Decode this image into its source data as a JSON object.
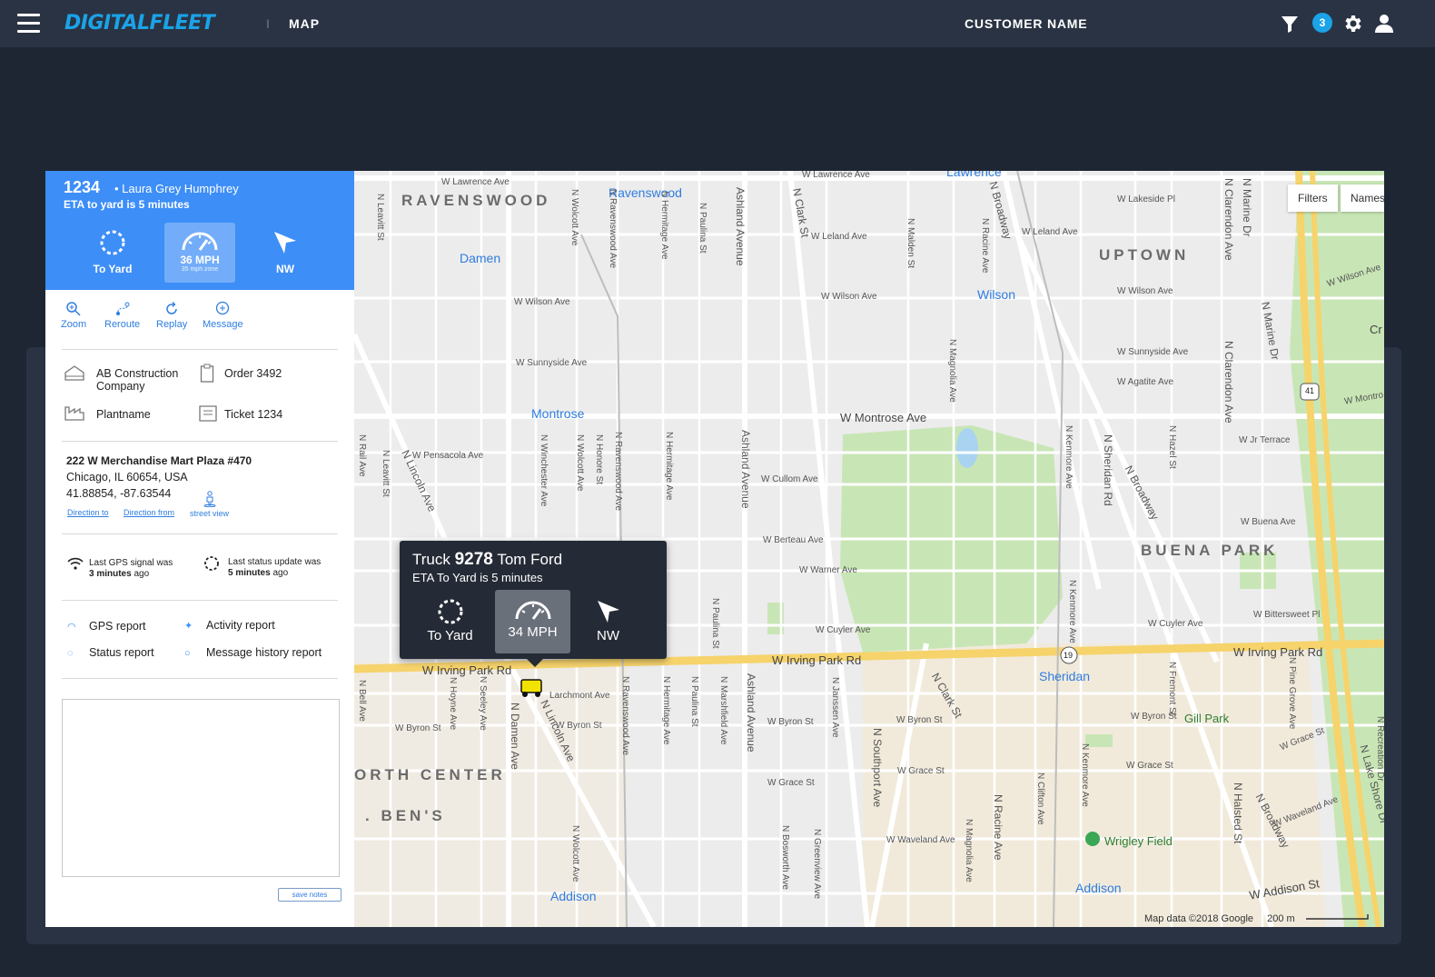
{
  "header": {
    "logo": "DIGITALFLEET",
    "separator": "I",
    "page_title": "MAP",
    "customer_name": "CUSTOMER NAME",
    "notification_count": "3"
  },
  "panel": {
    "truck_number": "1234",
    "driver": "• Laura Grey Humphrey",
    "eta": "ETA to yard is 5 minutes",
    "buttons": {
      "destination": "To Yard",
      "speed": "36 MPH",
      "speed_zone": "35 mph zone",
      "heading": "NW"
    },
    "actions": {
      "zoom": "Zoom",
      "reroute": "Reroute",
      "replay": "Replay",
      "message": "Message"
    },
    "info": {
      "company": "AB Construction Company",
      "order": "Order 3492",
      "plant": "Plantname",
      "ticket": "Ticket 1234"
    },
    "address": {
      "line1": "222 W Merchandise Mart Plaza #470",
      "line2": "Chicago, IL 60654, USA",
      "coords": "41.88854, -87.63544",
      "direction_to": "Direction to",
      "direction_from": "Direction from",
      "street_view": "street view"
    },
    "status": {
      "gps_prefix": "Last GPS signal was",
      "gps_time": "3 minutes",
      "gps_suffix": "ago",
      "update_prefix": "Last status update was",
      "update_time": "5 minutes",
      "update_suffix": "ago"
    },
    "reports": {
      "gps": "GPS report",
      "activity": "Activity report",
      "status": "Status report",
      "message_history": "Message history report"
    },
    "notes": {
      "value": "",
      "save_label": "save notes"
    }
  },
  "map": {
    "filters_label": "Filters",
    "names_label": "Names",
    "attribution": "Map data ©2018 Google",
    "scale": "200 m",
    "areas": {
      "ravenswood": "RAVENSWOOD",
      "uptown": "UPTOWN",
      "buena_park": "BUENA PARK",
      "north_center": "ORTH CENTER",
      "st_bens": ". BEN'S"
    },
    "stations": {
      "ravenswood": "Ravenswood",
      "damen": "Damen",
      "wilson": "Wilson",
      "montrose": "Montrose",
      "sheridan": "Sheridan",
      "addison_w": "Addison",
      "addison_e": "Addison",
      "lawrence": "Lawrence"
    },
    "places": {
      "gill_park": "Gill Park",
      "wrigley_field": "Wrigley Field"
    },
    "streets": {
      "lawrence_w": "W Lawrence Ave",
      "lawrence_e": "W Lawrence Ave",
      "leland_w": "W Leland Ave",
      "leland_e": "W Leland Ave",
      "wilson_w": "W Wilson Ave",
      "wilson_m": "W Wilson Ave",
      "wilson_e": "W Wilson Ave",
      "sunnyside_w": "W Sunnyside Ave",
      "sunnyside_e": "W Sunnyside Ave",
      "agatite": "W Agatite Ave",
      "montrose": "W Montrose Ave",
      "pensacola": "W Pensacola Ave",
      "cullom": "W Cullom Ave",
      "berteau": "W Berteau Ave",
      "warner": "W Warner Ave",
      "cuyler_m": "W Cuyler Ave",
      "cuyler_e": "W Cuyler Ave",
      "irving_w": "W Irving Park Rd",
      "irving_m": "W Irving Park Rd",
      "irving_e": "W Irving Park Rd",
      "larchmont": "Larchmont Ave",
      "byron_w": "W Byron St",
      "byron_w2": "W Byron St",
      "byron_m": "W Byron St",
      "byron_e": "W Byron St",
      "byron_e2": "W Byron St",
      "grace_m": "W Grace St",
      "grace_e": "W Grace St",
      "grace_e2": "W Grace St",
      "grace_e3": "W Grace St",
      "waveland": "W Waveland Ave",
      "waveland_e": "W Waveland Ave",
      "addison_st": "W Addison St",
      "jr_terrace": "W Jr Terrace",
      "buena": "W Buena Ave",
      "bittersweet": "W Bittersweet Pl",
      "lakeside": "W Lakeside Pl",
      "ashland_n": "Ashland Avenue",
      "ashland_m": "Ashland Avenue",
      "ashland_s": "Ashland Avenue",
      "clark_n": "N Clark St",
      "clark_s": "N Clark St",
      "broadway_n": "N Broadway",
      "broadway_m": "N Broadway",
      "broadway_s": "N Broadway",
      "sheridan": "N Sheridan Rd",
      "lincoln_n": "N Lincoln Ave",
      "lincoln_s": "N Lincoln Ave",
      "damen": "N Damen Ave",
      "southport": "N Southport Ave",
      "racine": "N Racine Ave",
      "halsted": "N Halsted St",
      "clarendon": "N Clarendon Ave",
      "clarendon_s": "N Clarendon Ave",
      "marine": "N Marine Dr",
      "marine_s": "N Marine Dr",
      "lake_shore": "N Lake Shore Dr",
      "wolcott": "N Wolcott Ave",
      "ravenswood": "N Ravenswood Ave",
      "hermitage": "N Hermitage Ave",
      "paulina": "N Paulina St",
      "leavitt": "N Leavitt St",
      "winchester": "N Winchester Ave",
      "honore": "N Honore St",
      "magnolia": "N Magnolia Ave",
      "kenmore": "N Kenmore Ave",
      "hazel": "N Hazel St",
      "malden": "N Malden St",
      "racine_n": "N Racine Ave",
      "pine_grove": "N Pine Grove Ave",
      "recreation": "N Recreation Dr",
      "fremont": "N Fremont St",
      "clifton": "N Clifton Ave",
      "seeley": "N Seeley Ave",
      "hoyne": "N Hoyne Ave",
      "bell": "N Bell Ave",
      "rail": "N Rail Ave",
      "janssen": "N Janssen Ave",
      "marshfield": "N Marshfield Ave",
      "bosworth": "N Bosworth Ave",
      "greenview": "N Greenview Ave",
      "hwy_41": "41",
      "hwy_19": "19",
      "montrose_e": "W Montro",
      "cr": "Cr"
    }
  },
  "popup": {
    "truck_prefix": "Truck",
    "truck_number": "9278",
    "driver": "Tom Ford",
    "eta": "ETA To Yard is 5 minutes",
    "destination": "To Yard",
    "speed": "34 MPH",
    "heading": "NW"
  },
  "colors": {
    "accent": "#3d8ef7",
    "logo": "#1aa3e8",
    "header_bg": "#2a3343",
    "page_bg": "#1e2633",
    "park": "#c8e6b5",
    "highway": "#f6d36b"
  }
}
